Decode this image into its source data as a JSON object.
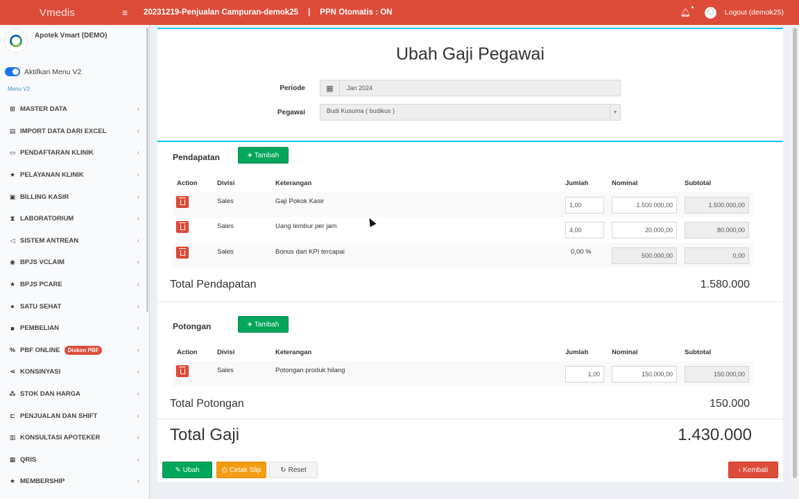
{
  "header": {
    "brand": "Vmedis",
    "menu_icon": "hamburger-icon",
    "title": "20231219-Penjualan Campuran-demok25",
    "separator": "|",
    "ppn_status": "PPN Otomatis : ON",
    "notification_icon": "bell-icon",
    "logout_label": "Logout (demok25)"
  },
  "sidebar": {
    "store_name": "Apotek Vmart (DEMO)",
    "toggle_label": "Aktifkan Menu V2",
    "menu_label": "Menu V2",
    "items": [
      {
        "label": "MASTER DATA",
        "icon": "plus-square-icon"
      },
      {
        "label": "IMPORT DATA DARI EXCEL",
        "icon": "file-excel-icon"
      },
      {
        "label": "PENDAFTARAN KLINIK",
        "icon": "desktop-icon"
      },
      {
        "label": "PELAYANAN KLINIK",
        "icon": "star-icon"
      },
      {
        "label": "BILLING KASIR",
        "icon": "money-icon"
      },
      {
        "label": "LABORATORIUM",
        "icon": "hourglass-icon"
      },
      {
        "label": "SISTEM ANTREAN",
        "icon": "bullhorn-icon"
      },
      {
        "label": "BPJS VCLAIM",
        "icon": "globe-icon"
      },
      {
        "label": "BPJS PCARE",
        "icon": "star-icon"
      },
      {
        "label": "SATU SEHAT",
        "icon": "circle-icon"
      },
      {
        "label": "PEMBELIAN",
        "icon": "truck-icon"
      },
      {
        "label": "PBF ONLINE",
        "icon": "percent-icon",
        "badge": "Diskon PBF"
      },
      {
        "label": "KONSINYASI",
        "icon": "share-icon"
      },
      {
        "label": "STOK DAN HARGA",
        "icon": "cubes-icon"
      },
      {
        "label": "PENJUALAN DAN SHIFT",
        "icon": "cart-icon"
      },
      {
        "label": "KONSULTASI APOTEKER",
        "icon": "book-icon"
      },
      {
        "label": "QRIS",
        "icon": "qrcode-icon"
      },
      {
        "label": "MEMBERSHIP",
        "icon": "star-icon"
      }
    ]
  },
  "form": {
    "title": "Ubah Gaji Pegawai",
    "periode_label": "Periode",
    "periode_value": "Jan 2024",
    "pegawai_label": "Pegawai",
    "pegawai_value": "Budi Kusuma ( budikus )"
  },
  "columns": {
    "action": "Action",
    "divisi": "Divisi",
    "keterangan": "Keterangan",
    "jumlah": "Jumlah",
    "nominal": "Nominal",
    "subtotal": "Subtotal"
  },
  "pendapatan": {
    "title": "Pendapatan",
    "add_label": "Tambah",
    "rows": [
      {
        "divisi": "Sales",
        "keterangan": "Gaji Pokok Kasir",
        "jumlah": "1,00",
        "nominal": "1.500.000,00",
        "subtotal": "1.500.000,00"
      },
      {
        "divisi": "Sales",
        "keterangan": "Uang lembur per jam",
        "jumlah": "4,00",
        "nominal": "20.000,00",
        "subtotal": "80.000,00"
      },
      {
        "divisi": "Sales",
        "keterangan": "Bonus dari KPI tercapai",
        "jumlah": "0,00 %",
        "nominal": "500.000,00",
        "subtotal": "0,00"
      }
    ],
    "total_label": "Total Pendapatan",
    "total_value": "1.580.000"
  },
  "potongan": {
    "title": "Potongan",
    "add_label": "Tambah",
    "rows": [
      {
        "divisi": "Sales",
        "keterangan": "Potongan produk hilang",
        "jumlah": "1,00",
        "nominal": "150.000,00",
        "subtotal": "150.000,00"
      }
    ],
    "total_label": "Total Potongan",
    "total_value": "150.000"
  },
  "grand_total": {
    "label": "Total Gaji",
    "value": "1.430.000"
  },
  "actions": {
    "ubah": "Ubah",
    "cetak": "Cetak Slip",
    "reset": "Reset",
    "kembali": "Kembali"
  }
}
